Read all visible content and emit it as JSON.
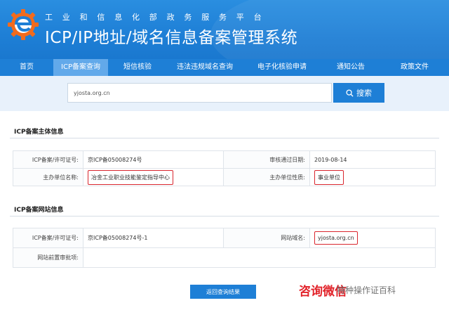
{
  "header": {
    "subtitle": "工业和信息化部政务服务平台",
    "title": "ICP/IP地址/域名信息备案管理系统",
    "logo_icon": "e-logo-icon"
  },
  "nav": {
    "items": [
      {
        "label": "首页"
      },
      {
        "label": "ICP备案查询",
        "active": true
      },
      {
        "label": "短信核验"
      },
      {
        "label": "违法违规域名查询"
      },
      {
        "label": "电子化核验申请"
      },
      {
        "label": "通知公告"
      },
      {
        "label": "政策文件"
      }
    ]
  },
  "search": {
    "value": "yjosta.org.cn",
    "button_label": "搜索",
    "button_icon": "search-icon"
  },
  "section1": {
    "title": "ICP备案主体信息",
    "license_label": "ICP备案/许可证号:",
    "license_value": "京ICP备05008274号",
    "date_label": "审核通过日期:",
    "date_value": "2019-08-14",
    "org_label": "主办单位名称:",
    "org_value": "冶金工业职业技能鉴定指导中心",
    "nature_label": "主办单位性质:",
    "nature_value": "事业单位"
  },
  "section2": {
    "title": "ICP备案网站信息",
    "license_label": "ICP备案/许可证号:",
    "license_value": "京ICP备05008274号-1",
    "domain_label": "网站域名:",
    "domain_value": "yjosta.org.cn",
    "preapproval_label": "网站前置审批项:",
    "preapproval_value": ""
  },
  "footer": {
    "back_label": "返回查询结果"
  },
  "watermark": {
    "red_text": "咨询微信",
    "gray_text": "特种操作证百科"
  },
  "colors": {
    "primary": "#1e7fd6",
    "nav_active": "#62a9ea",
    "highlight_border": "#d9262e",
    "watermark_red": "#e2232a"
  }
}
